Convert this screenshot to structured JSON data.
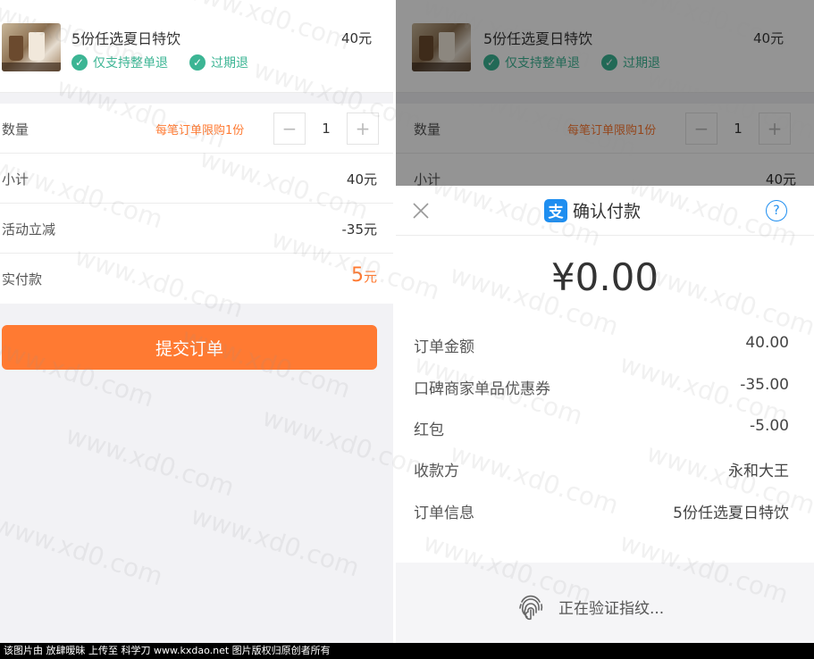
{
  "left": {
    "product": {
      "title": "5份任选夏日特饮",
      "price": "40元",
      "tags": [
        "仅支持整单退",
        "过期退"
      ]
    },
    "quantity": {
      "label": "数量",
      "limit": "每笔订单限购1份",
      "minus": "−",
      "value": "1",
      "plus": "+"
    },
    "subtotal": {
      "label": "小计",
      "value": "40元"
    },
    "discount": {
      "label": "活动立减",
      "value": "-35元"
    },
    "payable": {
      "label": "实付款",
      "amount": "5",
      "unit": "元"
    },
    "submit_label": "提交订单"
  },
  "right": {
    "background": {
      "product_title": "5份任选夏日特饮",
      "product_price": "40元",
      "tags": [
        "仅支持整单退",
        "过期退"
      ],
      "quantity_label": "数量",
      "limit": "每笔订单限购1份",
      "quantity_value": "1",
      "subtotal_label": "小计",
      "subtotal_value": "40元"
    },
    "sheet": {
      "app_glyph": "支",
      "title": "确认付款",
      "help_glyph": "?",
      "amount": "¥0.00",
      "details": [
        {
          "label": "订单金额",
          "value": "40.00"
        },
        {
          "label": "口碑商家单品优惠券",
          "value": "-35.00"
        },
        {
          "label": "红包",
          "value": "-5.00"
        },
        {
          "label": "收款方",
          "value": "永和大王"
        },
        {
          "label": "订单信息",
          "value": "5份任选夏日特饮"
        }
      ],
      "fingerprint_text": "正在验证指纹..."
    }
  },
  "watermark_text": "www.xd0.com",
  "footer_text": "该图片由 放肆暧昧 上传至 科学刀 www.kxdao.net 图片版权归原创者所有",
  "colors": {
    "accent": "#ff7a32",
    "green": "#3cb594",
    "alipay_blue": "#1e8ef0"
  }
}
